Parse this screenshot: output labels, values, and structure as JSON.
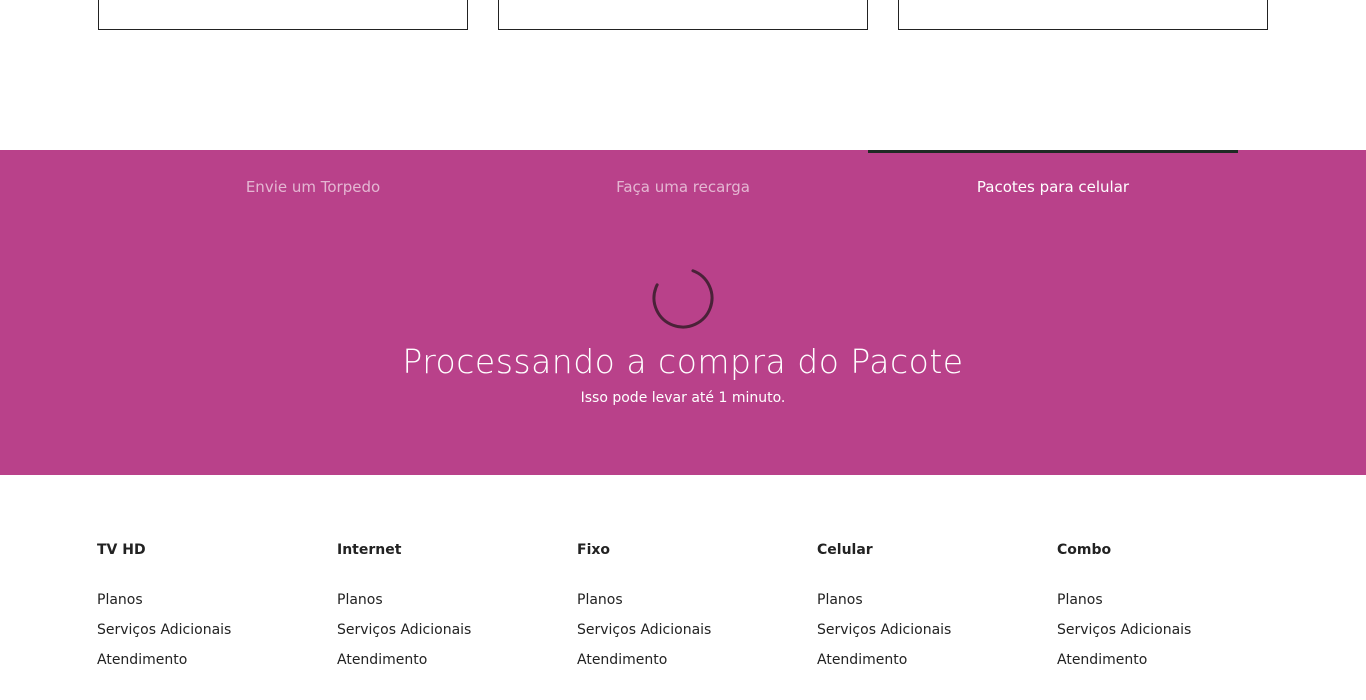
{
  "tabs": [
    {
      "label": "Envie um Torpedo",
      "active": false
    },
    {
      "label": "Faça uma recarga",
      "active": false
    },
    {
      "label": "Pacotes para celular",
      "active": true
    }
  ],
  "processing": {
    "title": "Processando a compra do Pacote",
    "subtitle": "Isso pode levar até 1 minuto."
  },
  "colors": {
    "band": "#b9418a",
    "active_tab_indicator": "#1f2a24",
    "text": "#222222"
  },
  "footer": {
    "columns": [
      {
        "title": "TV HD",
        "links": [
          "Planos",
          "Serviços Adicionais",
          "Atendimento"
        ]
      },
      {
        "title": "Internet",
        "links": [
          "Planos",
          "Serviços Adicionais",
          "Atendimento"
        ]
      },
      {
        "title": "Fixo",
        "links": [
          "Planos",
          "Serviços Adicionais",
          "Atendimento"
        ]
      },
      {
        "title": "Celular",
        "links": [
          "Planos",
          "Serviços Adicionais",
          "Atendimento"
        ]
      },
      {
        "title": "Combo",
        "links": [
          "Planos",
          "Serviços Adicionais",
          "Atendimento"
        ]
      }
    ]
  }
}
